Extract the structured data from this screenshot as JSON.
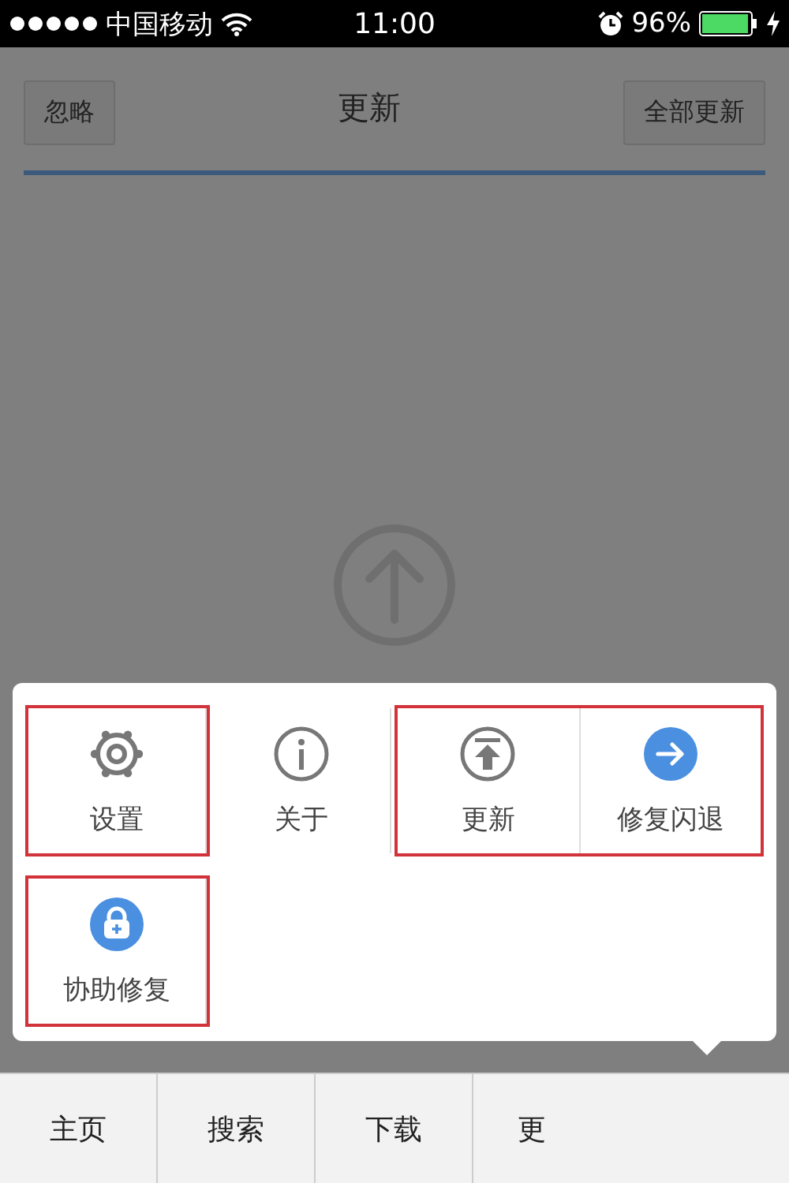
{
  "status_bar": {
    "carrier": "中国移动",
    "time": "11:00",
    "battery": "96%"
  },
  "header": {
    "left_button": "忽略",
    "title": "更新",
    "right_button": "全部更新"
  },
  "menu": {
    "rows": [
      {
        "groups": [
          {
            "framed": true,
            "items": [
              {
                "kind": "gear",
                "label": "设置"
              }
            ]
          },
          {
            "framed": false,
            "items": [
              {
                "kind": "info",
                "label": "关于"
              }
            ]
          },
          {
            "framed": true,
            "items": [
              {
                "kind": "upload",
                "label": "更新"
              },
              {
                "kind": "arrow",
                "label": "修复闪退"
              }
            ]
          }
        ]
      },
      {
        "groups": [
          {
            "framed": true,
            "items": [
              {
                "kind": "kit",
                "label": "协助修复"
              }
            ]
          }
        ]
      }
    ]
  },
  "tab_bar": {
    "tabs": [
      "主页",
      "搜索",
      "下载",
      "更"
    ]
  }
}
